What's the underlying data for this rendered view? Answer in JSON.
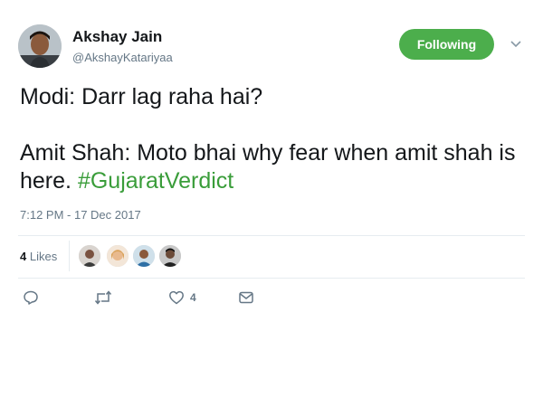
{
  "author": {
    "name": "Akshay Jain",
    "handle": "@AkshayKatariyaa"
  },
  "follow_button": {
    "label": "Following",
    "color": "#4cae4c"
  },
  "tweet": {
    "text_line1": "Modi: Darr lag raha hai?",
    "text_line2": "Amit Shah: Moto bhai why fear when amit shah is here. ",
    "hashtag": "#GujaratVerdict",
    "timestamp": "7:12 PM - 17 Dec 2017"
  },
  "stats": {
    "likes_count": "4",
    "likes_label": "Likes"
  },
  "actions": {
    "like_count": "4"
  },
  "icons": [
    "reply-icon",
    "retweet-icon",
    "heart-icon",
    "direct-message-icon",
    "chevron-down-icon"
  ]
}
